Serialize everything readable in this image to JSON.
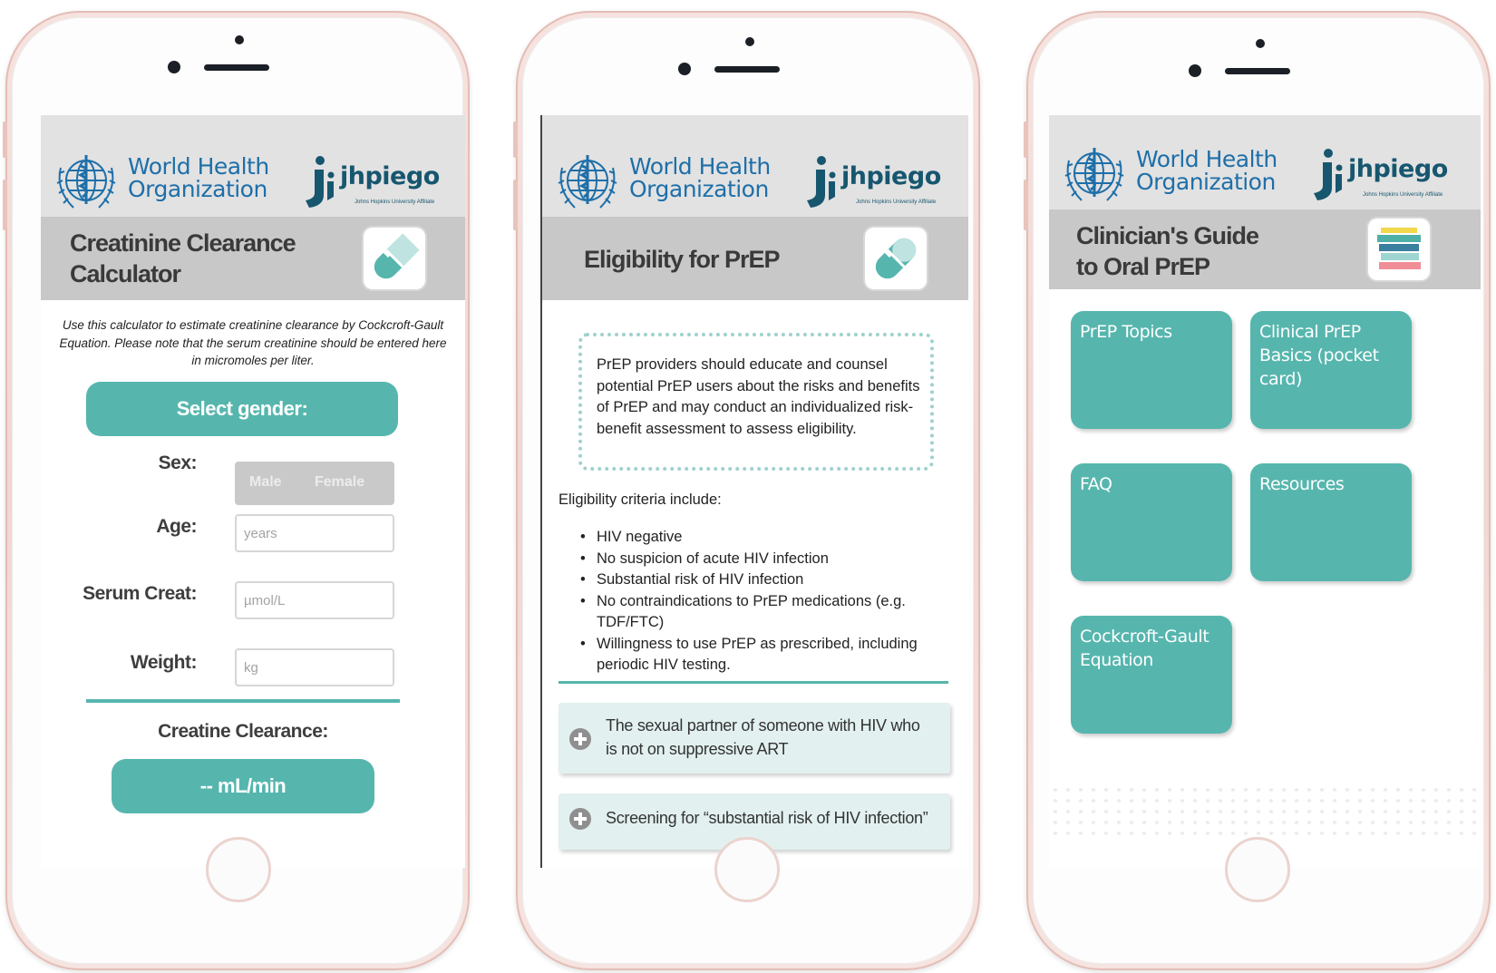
{
  "header": {
    "who_line1": "World Health",
    "who_line2": "Organization",
    "jhpiego_name": "jhpiego",
    "jhpiego_sub": "Johns Hopkins University Affiliate"
  },
  "calculator": {
    "title_line1": "Creatinine Clearance",
    "title_line2": "Calculator",
    "intro": "Use this calculator to estimate creatinine clearance by Cockcroft-Gault Equation. Please note that the serum creatinine should be entered here in micromoles per liter.",
    "select_gender_label": "Select gender:",
    "sex_label": "Sex:",
    "sex_options": [
      "Male",
      "Female"
    ],
    "age_label": "Age:",
    "age_placeholder": "years",
    "serum_label": "Serum Creat:",
    "serum_placeholder": "µmol/L",
    "weight_label": "Weight:",
    "weight_placeholder": "kg",
    "result_label": "Creatine Clearance:",
    "result_value": "-- mL/min"
  },
  "eligibility": {
    "title": "Eligibility for PrEP",
    "callout": "PrEP providers should educate and counsel potential PrEP users about the risks and benefits of PrEP and may conduct an individualized risk-benefit assessment to assess eligibility.",
    "criteria_heading": "Eligibility criteria include:",
    "criteria": [
      "HIV negative",
      "No suspicion of acute HIV infection",
      "Substantial risk of HIV infection",
      "No contraindications to PrEP medications (e.g. TDF/FTC)",
      "Willingness to use PrEP as prescribed, including periodic HIV testing."
    ],
    "accordions": [
      "The sexual partner of someone with HIV who is not on suppressive ART",
      "Screening for “substantial risk of HIV infection”"
    ]
  },
  "guide": {
    "title_line1": "Clinician's Guide",
    "title_line2": "to Oral PrEP",
    "tiles": [
      "PrEP Topics",
      "Clinical PrEP Basics (pocket card)",
      "FAQ",
      "Resources",
      "Cockcroft-Gault Equation"
    ]
  },
  "colors": {
    "teal": "#56b6ae",
    "who_blue": "#1e6fa9",
    "jhpiego_navy": "#17566f",
    "title_bar": "#c8c8c8"
  }
}
